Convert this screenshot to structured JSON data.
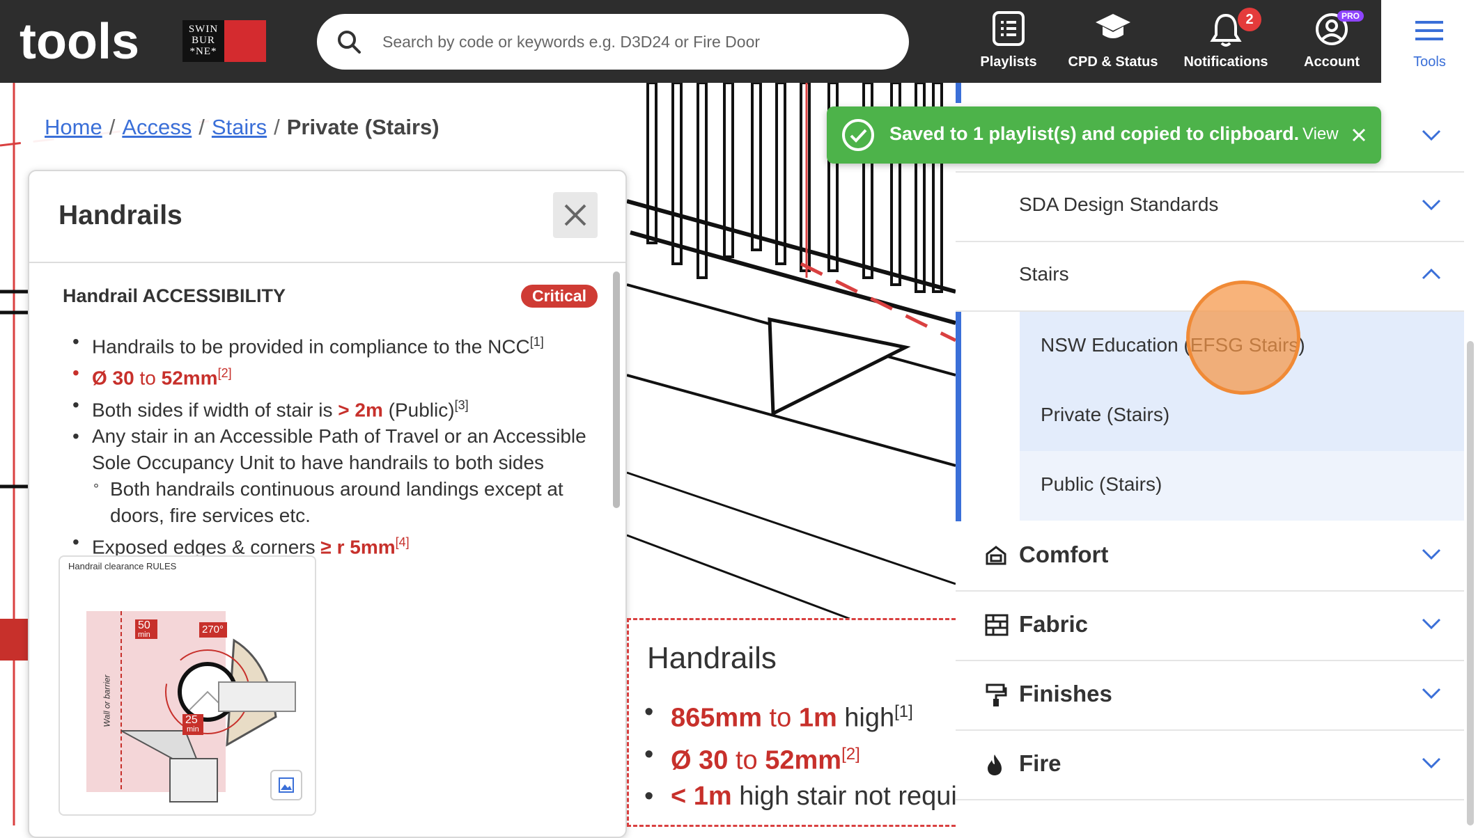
{
  "app": {
    "logo_text": "tools",
    "partner_lines": [
      "SWIN",
      "BUR",
      "*NE*"
    ]
  },
  "search": {
    "placeholder": "Search by code or keywords e.g. D3D24 or Fire Door"
  },
  "nav": {
    "playlists": "Playlists",
    "cpd": "CPD & Status",
    "notifications": "Notifications",
    "notifications_count": "2",
    "account": "Account",
    "account_badge": "PRO",
    "tools": "Tools"
  },
  "breadcrumb": {
    "home": "Home",
    "access": "Access",
    "stairs": "Stairs",
    "current": "Private (Stairs)",
    "sep": "/"
  },
  "detail": {
    "title": "Handrails",
    "section_title": "Handrail ACCESSIBILITY",
    "badge": "Critical",
    "b1_text": "Handrails to be provided in compliance to the NCC",
    "b1_ref": "[1]",
    "b2_a": "Ø 30",
    "b2_b": "to",
    "b2_c": "52mm",
    "b2_ref": "[2]",
    "b3_text": "Both sides if width of stair is",
    "b3_val": "> 2m",
    "b3_tail": "(Public)",
    "b3_ref": "[3]",
    "b4_text": "Any stair in an Accessible Path of Travel or an Accessible Sole Occupancy Unit to have handrails to both sides",
    "b5_text": "Both handrails continuous around landings except at doors, fire services etc.",
    "b6_text": "Exposed edges & corners",
    "b6_val": "≥ r 5mm",
    "b6_ref": "[4]",
    "image_caption": "Handrail clearance RULES",
    "img_50": "50",
    "img_min": "min",
    "img_270": "270°",
    "img_25": "25",
    "img_wall": "Wall or barrier"
  },
  "callout": {
    "title": "Handrails",
    "l1_a": "865mm",
    "l1_b": "to",
    "l1_c": "1m",
    "l1_d": "high",
    "l1_ref": "[1]",
    "l2_a": "Ø 30",
    "l2_b": "to",
    "l2_c": "52mm",
    "l2_ref": "[2]",
    "l3_a": "< 1m",
    "l3_b": "high stair not require"
  },
  "toast": {
    "message": "Saved to 1 playlist(s) and copied to clipboard.",
    "view": "View"
  },
  "sidebar": {
    "sda": "SDA Design Standards",
    "stairs": "Stairs",
    "stairs_items": [
      "NSW Education (EFSG Stairs)",
      "Private (Stairs)",
      "Public (Stairs)"
    ],
    "categories": [
      "Comfort",
      "Fabric",
      "Finishes",
      "Fire"
    ]
  },
  "colors": {
    "accent": "#3a6fd8",
    "critical": "#cf3b34",
    "toast": "#4db34a",
    "topbar": "#2d2d2d",
    "selected": "#e3ecfb"
  }
}
